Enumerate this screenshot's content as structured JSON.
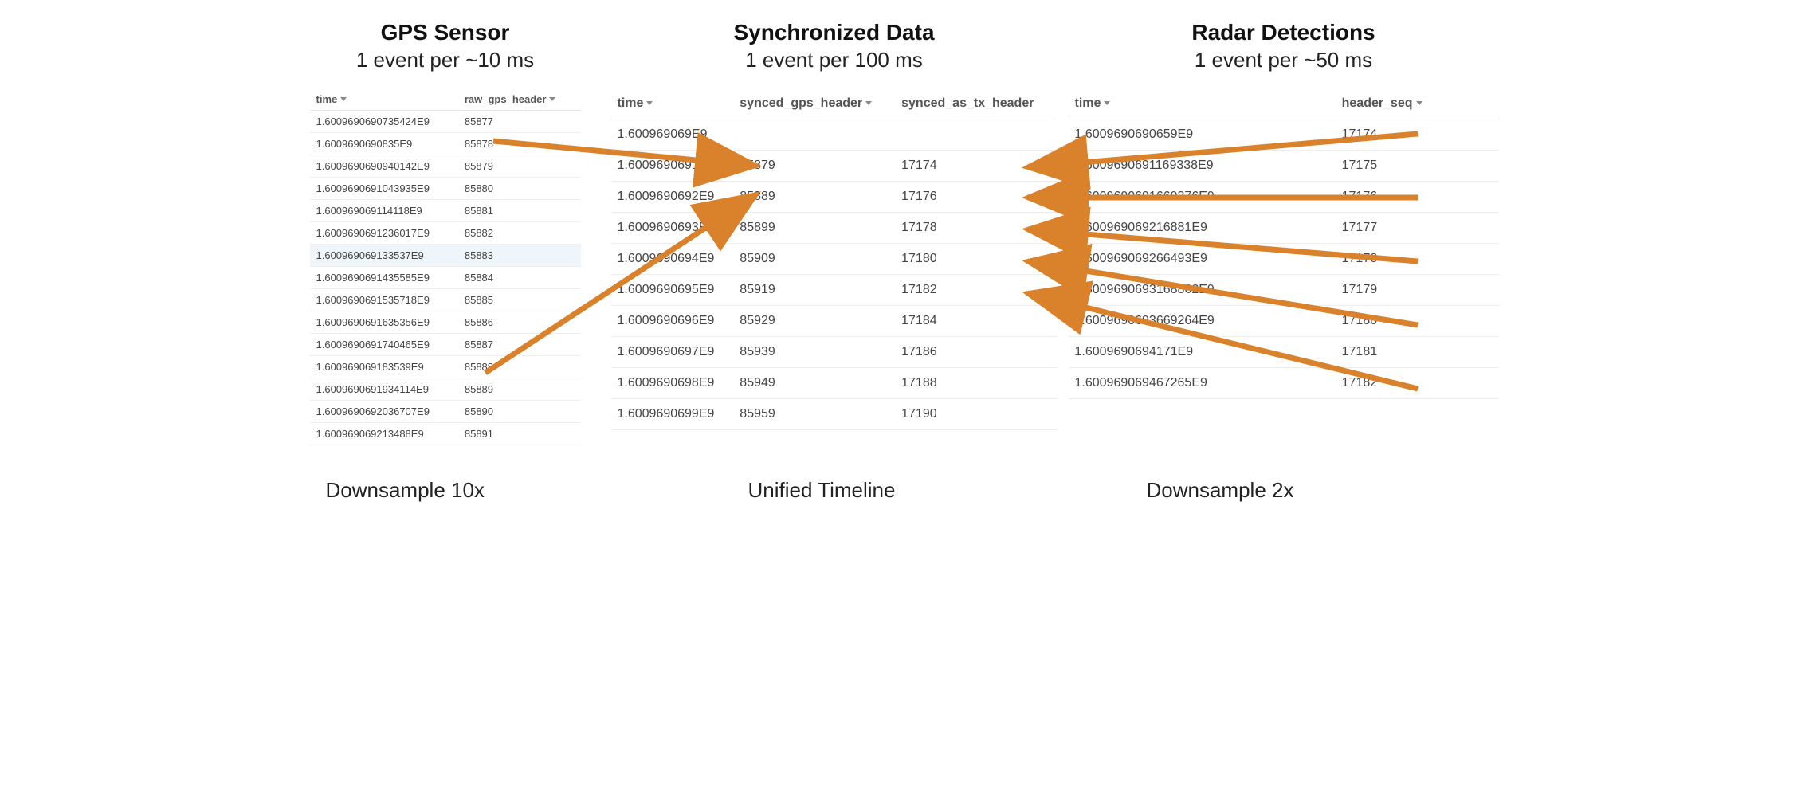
{
  "gps": {
    "title": "GPS Sensor",
    "subtitle": "1 event per ~10 ms",
    "footer": "Downsample 10x",
    "columns": {
      "time": "time",
      "header": "raw_gps_header"
    },
    "rows": [
      {
        "time": "1.6009690690735424E9",
        "header": "85877"
      },
      {
        "time": "1.6009690690835E9",
        "header": "85878"
      },
      {
        "time": "1.6009690690940142E9",
        "header": "85879"
      },
      {
        "time": "1.6009690691043935E9",
        "header": "85880"
      },
      {
        "time": "1.600969069114118E9",
        "header": "85881"
      },
      {
        "time": "1.6009690691236017E9",
        "header": "85882"
      },
      {
        "time": "1.600969069133537E9",
        "header": "85883",
        "highlight": true
      },
      {
        "time": "1.6009690691435585E9",
        "header": "85884"
      },
      {
        "time": "1.6009690691535718E9",
        "header": "85885"
      },
      {
        "time": "1.6009690691635356E9",
        "header": "85886"
      },
      {
        "time": "1.6009690691740465E9",
        "header": "85887"
      },
      {
        "time": "1.600969069183539E9",
        "header": "85888"
      },
      {
        "time": "1.6009690691934114E9",
        "header": "85889"
      },
      {
        "time": "1.6009690692036707E9",
        "header": "85890"
      },
      {
        "time": "1.600969069213488E9",
        "header": "85891"
      }
    ]
  },
  "sync": {
    "title": "Synchronized Data",
    "subtitle": "1 event per 100 ms",
    "footer": "Unified Timeline",
    "columns": {
      "time": "time",
      "gps": "synced_gps_header",
      "tx": "synced_as_tx_header"
    },
    "rows": [
      {
        "time": "1.600969069E9",
        "gps": "",
        "tx": ""
      },
      {
        "time": "1.6009690691E9",
        "gps": "85879",
        "tx": "17174"
      },
      {
        "time": "1.6009690692E9",
        "gps": "85889",
        "tx": "17176"
      },
      {
        "time": "1.6009690693E9",
        "gps": "85899",
        "tx": "17178"
      },
      {
        "time": "1.6009690694E9",
        "gps": "85909",
        "tx": "17180"
      },
      {
        "time": "1.6009690695E9",
        "gps": "85919",
        "tx": "17182"
      },
      {
        "time": "1.6009690696E9",
        "gps": "85929",
        "tx": "17184"
      },
      {
        "time": "1.6009690697E9",
        "gps": "85939",
        "tx": "17186"
      },
      {
        "time": "1.6009690698E9",
        "gps": "85949",
        "tx": "17188"
      },
      {
        "time": "1.6009690699E9",
        "gps": "85959",
        "tx": "17190"
      }
    ]
  },
  "radar": {
    "title": "Radar Detections",
    "subtitle": "1 event per ~50 ms",
    "footer": "Downsample 2x",
    "columns": {
      "time": "time",
      "header": "header_seq"
    },
    "rows": [
      {
        "time": "1.6009690690659E9",
        "header": "17174"
      },
      {
        "time": "1.6009690691169338E9",
        "header": "17175"
      },
      {
        "time": "1.6009690691669376E9",
        "header": "17176"
      },
      {
        "time": "1.600969069216881E9",
        "header": "17177"
      },
      {
        "time": "1.600969069266493E9",
        "header": "17178"
      },
      {
        "time": "1.6009690693168862E9",
        "header": "17179"
      },
      {
        "time": "1.6009690693669264E9",
        "header": "17180"
      },
      {
        "time": "1.6009690694171E9",
        "header": "17181"
      },
      {
        "time": "1.600969069467265E9",
        "header": "17182"
      }
    ]
  },
  "arrow_color": "#d9822b"
}
